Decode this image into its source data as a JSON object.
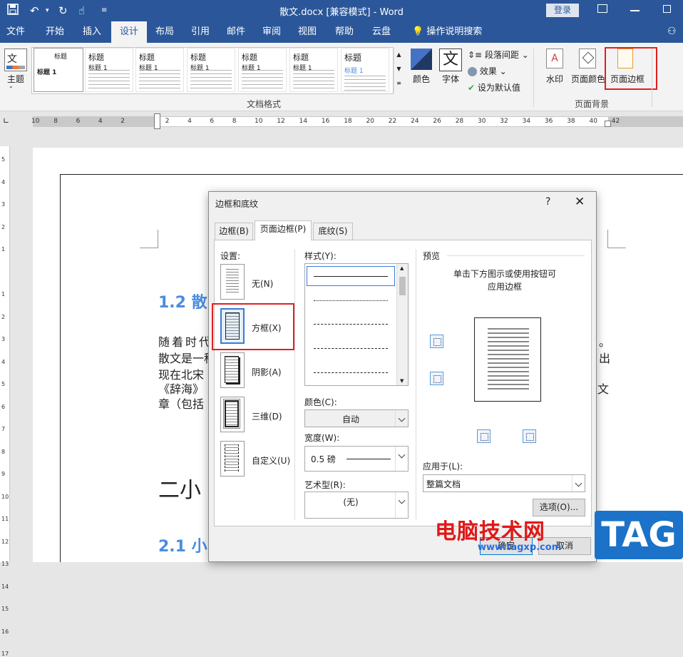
{
  "titlebar": {
    "doc_title": "散文.docx [兼容模式] - Word",
    "login": "登录"
  },
  "tabs": [
    "文件",
    "开始",
    "插入",
    "设计",
    "布局",
    "引用",
    "邮件",
    "审阅",
    "视图",
    "帮助",
    "云盘"
  ],
  "active_tab": "设计",
  "tell_me": "操作说明搜索",
  "ribbon": {
    "theme_label": "主题",
    "doc_format_group": "文档格式",
    "styles": [
      {
        "title": "标题",
        "subtitle": "标题 1"
      },
      {
        "title": "标题",
        "subtitle": "标题 1"
      },
      {
        "title": "标题",
        "subtitle": "标题 1"
      },
      {
        "title": "标题",
        "subtitle": "标题 1"
      },
      {
        "title": "标题",
        "subtitle": "标题 1"
      },
      {
        "title": "标题",
        "subtitle": "标题 1"
      },
      {
        "title": "标题",
        "subtitle": "标题 1"
      }
    ],
    "colors_label": "颜色",
    "fonts_label": "字体",
    "fonts_glyph": "文",
    "para_spacing": "段落间距",
    "effects": "效果",
    "set_default": "设为默认值",
    "watermark": "水印",
    "page_color": "页面颜色",
    "page_borders": "页面边框",
    "page_bg_group": "页面背景"
  },
  "ruler": {
    "numbers": [
      "10",
      "8",
      "6",
      "4",
      "2",
      "",
      "2",
      "4",
      "6",
      "8",
      "10",
      "12",
      "14",
      "16",
      "18",
      "20",
      "22",
      "24",
      "26",
      "28",
      "30",
      "32",
      "34",
      "36",
      "38",
      "40",
      "42"
    ],
    "vnumbers": [
      "5",
      "4",
      "3",
      "2",
      "1",
      "",
      "1",
      "2",
      "3",
      "4",
      "5",
      "6",
      "7",
      "8",
      "9",
      "10",
      "11",
      "12",
      "13",
      "14",
      "15",
      "16",
      "17"
    ]
  },
  "document": {
    "h1": "1.2 散",
    "body_lines": [
      "随着时代",
      "散文是一种",
      "现在北宋",
      "《辞海》",
      "章（包括"
    ],
    "right_fragments": [
      "。",
      "出",
      "",
      "文"
    ],
    "h2": "二小",
    "h3": "2.1 小"
  },
  "dialog": {
    "title": "边框和底纹",
    "help": "?",
    "close": "✕",
    "tabs": [
      "边框(B)",
      "页面边框(P)",
      "底纹(S)"
    ],
    "settings_label": "设置:",
    "settings": [
      "无(N)",
      "方框(X)",
      "阴影(A)",
      "三维(D)",
      "自定义(U)"
    ],
    "style_label": "样式(Y):",
    "color_label": "颜色(C):",
    "color_value": "自动",
    "width_label": "宽度(W):",
    "width_value": "0.5 磅",
    "art_label": "艺术型(R):",
    "art_value": "(无)",
    "preview_label": "预览",
    "preview_hint_1": "单击下方图示或使用按钮可",
    "preview_hint_2": "应用边框",
    "apply_label": "应用于(L):",
    "apply_value": "整篇文档",
    "options_button": "选项(O)...",
    "ok_button": "确定",
    "cancel_button": "取消"
  },
  "watermark": {
    "text": "电脑技术网",
    "url": "www.tagxp.com",
    "tag": "TAG"
  },
  "colors": {
    "title_bar": "#2b579a",
    "highlight": "#e02020",
    "heading_blue": "#4a8de0"
  }
}
